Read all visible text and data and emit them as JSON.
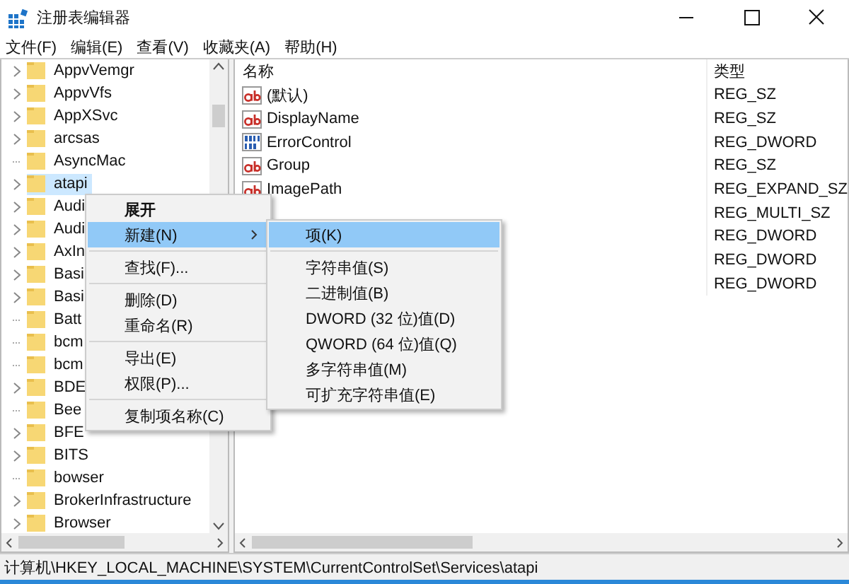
{
  "window": {
    "title": "注册表编辑器"
  },
  "menu": [
    "文件(F)",
    "编辑(E)",
    "查看(V)",
    "收藏夹(A)",
    "帮助(H)"
  ],
  "tree": [
    {
      "label": "AppvVemgr",
      "expandable": true,
      "selected": false
    },
    {
      "label": "AppvVfs",
      "expandable": true,
      "selected": false
    },
    {
      "label": "AppXSvc",
      "expandable": true,
      "selected": false
    },
    {
      "label": "arcsas",
      "expandable": true,
      "selected": false
    },
    {
      "label": "AsyncMac",
      "expandable": false,
      "selected": false
    },
    {
      "label": "atapi",
      "expandable": true,
      "selected": true
    },
    {
      "label": "Audi",
      "expandable": true,
      "selected": false
    },
    {
      "label": "Audi",
      "expandable": true,
      "selected": false
    },
    {
      "label": "AxIn",
      "expandable": true,
      "selected": false
    },
    {
      "label": "Basi",
      "expandable": true,
      "selected": false
    },
    {
      "label": "Basi",
      "expandable": true,
      "selected": false
    },
    {
      "label": "Batt",
      "expandable": false,
      "selected": false
    },
    {
      "label": "bcm",
      "expandable": false,
      "selected": false
    },
    {
      "label": "bcm",
      "expandable": false,
      "selected": false
    },
    {
      "label": "BDE",
      "expandable": true,
      "selected": false
    },
    {
      "label": "Bee",
      "expandable": false,
      "selected": false
    },
    {
      "label": "BFE",
      "expandable": true,
      "selected": false
    },
    {
      "label": "BITS",
      "expandable": true,
      "selected": false
    },
    {
      "label": "bowser",
      "expandable": false,
      "selected": false
    },
    {
      "label": "BrokerInfrastructure",
      "expandable": true,
      "selected": false
    },
    {
      "label": "Browser",
      "expandable": true,
      "selected": false
    }
  ],
  "values": {
    "columns": [
      "名称",
      "类型"
    ],
    "rows": [
      {
        "name": "(默认)",
        "kind": "string",
        "type": "REG_SZ"
      },
      {
        "name": "DisplayName",
        "kind": "string",
        "type": "REG_SZ"
      },
      {
        "name": "ErrorControl",
        "kind": "binary",
        "type": "REG_DWORD"
      },
      {
        "name": "Group",
        "kind": "string",
        "type": "REG_SZ"
      },
      {
        "name": "ImagePath",
        "kind": "string",
        "type": "REG_EXPAND_SZ"
      },
      {
        "type": "REG_MULTI_SZ"
      },
      {
        "type": "REG_DWORD"
      },
      {
        "type": "REG_DWORD"
      },
      {
        "type": "REG_DWORD"
      }
    ]
  },
  "context_menu": [
    {
      "kind": "item",
      "label": "展开",
      "bold": true,
      "selected": false
    },
    {
      "kind": "item",
      "label": "新建(N)",
      "submenu": true,
      "selected": true
    },
    {
      "kind": "separator"
    },
    {
      "kind": "item",
      "label": "查找(F)...",
      "selected": false
    },
    {
      "kind": "separator"
    },
    {
      "kind": "item",
      "label": "删除(D)",
      "selected": false
    },
    {
      "kind": "item",
      "label": "重命名(R)",
      "selected": false
    },
    {
      "kind": "separator"
    },
    {
      "kind": "item",
      "label": "导出(E)",
      "selected": false
    },
    {
      "kind": "item",
      "label": "权限(P)...",
      "selected": false
    },
    {
      "kind": "separator"
    },
    {
      "kind": "item",
      "label": "复制项名称(C)",
      "selected": false
    }
  ],
  "submenu": [
    {
      "kind": "item",
      "label": "项(K)",
      "selected": true
    },
    {
      "kind": "separator"
    },
    {
      "kind": "item",
      "label": "字符串值(S)",
      "selected": false
    },
    {
      "kind": "item",
      "label": "二进制值(B)",
      "selected": false
    },
    {
      "kind": "item",
      "label": "DWORD (32 位)值(D)",
      "selected": false
    },
    {
      "kind": "item",
      "label": "QWORD (64 位)值(Q)",
      "selected": false
    },
    {
      "kind": "item",
      "label": "多字符串值(M)",
      "selected": false
    },
    {
      "kind": "item",
      "label": "可扩充字符串值(E)",
      "selected": false
    }
  ],
  "status_bar": "计算机\\HKEY_LOCAL_MACHINE\\SYSTEM\\CurrentControlSet\\Services\\atapi"
}
